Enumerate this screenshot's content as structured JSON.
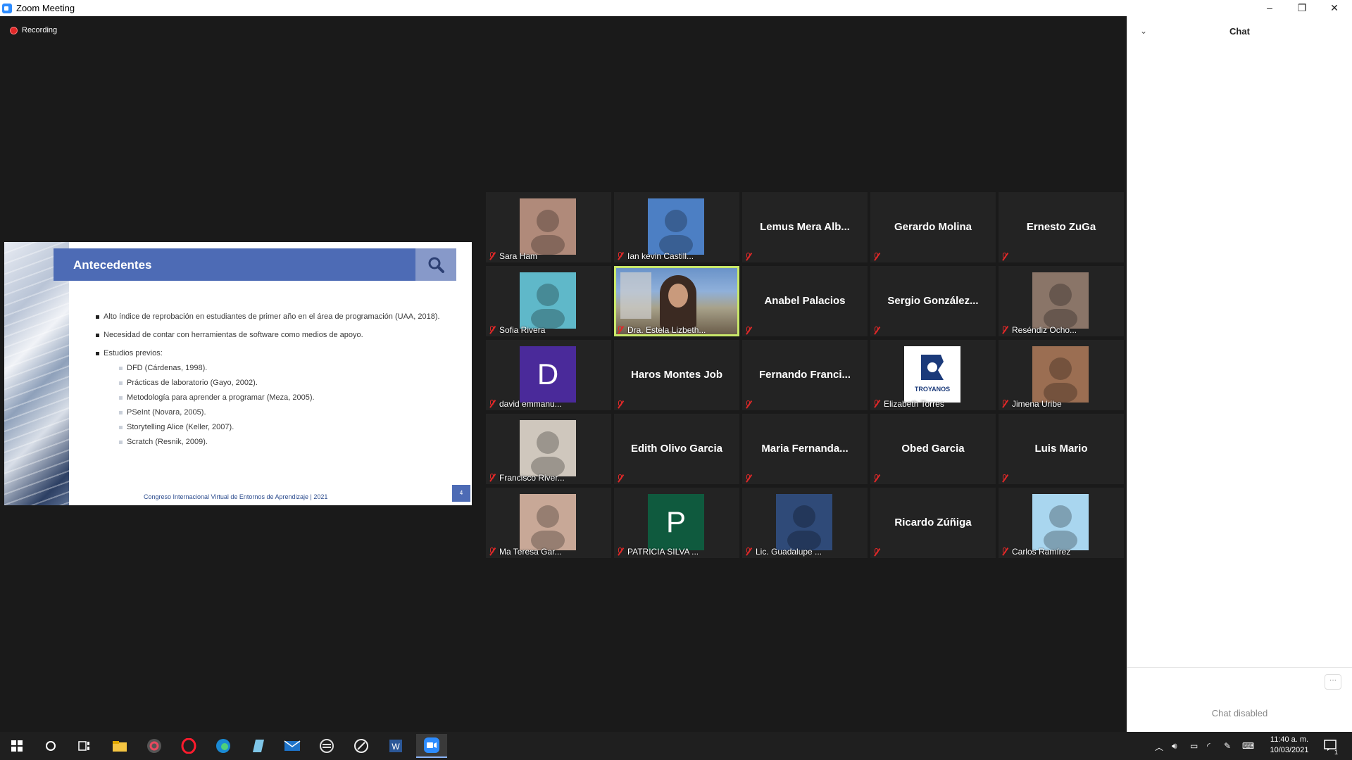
{
  "window": {
    "title": "Zoom Meeting",
    "minimize": "–",
    "restore": "❐",
    "close": "✕"
  },
  "meeting": {
    "recording_label": "Recording"
  },
  "slide": {
    "title": "Antecedentes",
    "bullets": [
      "Alto índice de reprobación en estudiantes de primer año en el área de programación (UAA, 2018).",
      "Necesidad de contar con herramientas de software como medios de apoyo.",
      "Estudios previos:"
    ],
    "sub_bullets": [
      "DFD (Cárdenas, 1998).",
      "Prácticas de laboratorio (Gayo, 2002).",
      "Metodología para aprender a programar (Meza, 2005).",
      "PSeInt (Novara, 2005).",
      "Storytelling Alice (Keller, 2007).",
      "Scratch (Resnik, 2009)."
    ],
    "footer": "Congreso Internacional Virtual de Entornos de Aprendizaje | 2021",
    "page_number": "4"
  },
  "participants": [
    {
      "label": "Sara Ham",
      "kind": "photo",
      "color": "#b08a7a"
    },
    {
      "label": "Ian kevin Castill...",
      "kind": "photo",
      "color": "#4c7fc4"
    },
    {
      "label": "",
      "big": "Lemus Mera Alb...",
      "kind": "name"
    },
    {
      "label": "",
      "big": "Gerardo Molina",
      "kind": "name"
    },
    {
      "label": "",
      "big": "Ernesto ZuGa",
      "kind": "name"
    },
    {
      "label": "Sofia Rivera",
      "kind": "photo",
      "color": "#5fb8c9"
    },
    {
      "label": "Dra. Estela Lizbeth...",
      "kind": "video"
    },
    {
      "label": "",
      "big": "Anabel Palacios",
      "kind": "name"
    },
    {
      "label": "",
      "big": "Sergio  González...",
      "kind": "name"
    },
    {
      "label": "Reséndiz Ocho...",
      "kind": "photo",
      "color": "#8a7568"
    },
    {
      "label": "david emmanu...",
      "kind": "letter",
      "letter": "D",
      "color": "#4a2a9a"
    },
    {
      "label": "",
      "big": "Haros Montes Job",
      "kind": "name"
    },
    {
      "label": "",
      "big": "Fernando  Franci...",
      "kind": "name"
    },
    {
      "label": "Elizabeth Torres",
      "kind": "logo",
      "logo_text": "TROYANOS",
      "color": "#ffffff"
    },
    {
      "label": "Jimena Uribe",
      "kind": "photo",
      "color": "#9b6e52"
    },
    {
      "label": "Francisco River...",
      "kind": "photo",
      "color": "#cfc7bd"
    },
    {
      "label": "",
      "big": "Edith Olivo Garcia",
      "kind": "name"
    },
    {
      "label": "",
      "big": "Maria  Fernanda...",
      "kind": "name"
    },
    {
      "label": "",
      "big": "Obed Garcia",
      "kind": "name"
    },
    {
      "label": "",
      "big": "Luis Mario",
      "kind": "name"
    },
    {
      "label": "Ma Teresa Gar...",
      "kind": "photo",
      "color": "#c8a897"
    },
    {
      "label": "PATRICIA SILVA ...",
      "kind": "letter",
      "letter": "P",
      "color": "#0f5a3e"
    },
    {
      "label": "Lic. Guadalupe ...",
      "kind": "photo",
      "color": "#2f4a78"
    },
    {
      "label": "",
      "big": "Ricardo Zúñiga",
      "kind": "name"
    },
    {
      "label": "Carlos Ramírez",
      "kind": "photo",
      "color": "#a9d6ef"
    }
  ],
  "chat": {
    "title": "Chat",
    "disabled_text": "Chat disabled",
    "more": "···"
  },
  "taskbar": {
    "icons": [
      "windows-start",
      "cortana",
      "task-view",
      "file-explorer",
      "chrome-like",
      "opera",
      "edge",
      "notepad",
      "mail",
      "app-circle",
      "app-pen",
      "word",
      "zoom"
    ],
    "time": "11:40 a. m.",
    "date": "10/03/2021",
    "notification_count": "1"
  }
}
